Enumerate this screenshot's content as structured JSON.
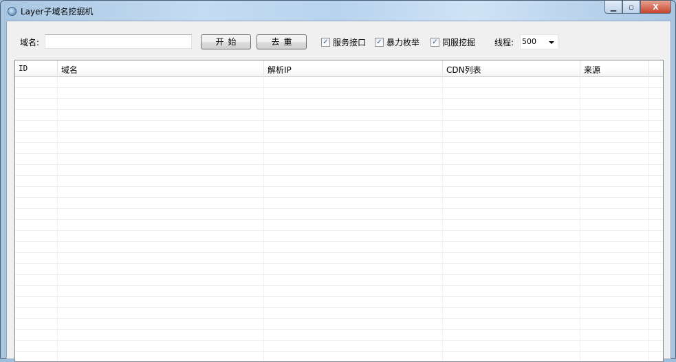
{
  "window": {
    "title": "Layer子域名挖掘机",
    "minimize": "▁",
    "maximize": "▫",
    "close": "X"
  },
  "toolbar": {
    "domain_label": "域名:",
    "domain_value": "",
    "start_label": "开始",
    "dedupe_label": "去重",
    "checkboxes": [
      {
        "label": "服务接口",
        "checked": true
      },
      {
        "label": "暴力枚举",
        "checked": true
      },
      {
        "label": "同服挖掘",
        "checked": true
      }
    ],
    "threads_label": "线程:",
    "threads_value": "500"
  },
  "table": {
    "columns": [
      "ID",
      "域名",
      "解析IP",
      "CDN列表",
      "来源"
    ],
    "rows": []
  }
}
